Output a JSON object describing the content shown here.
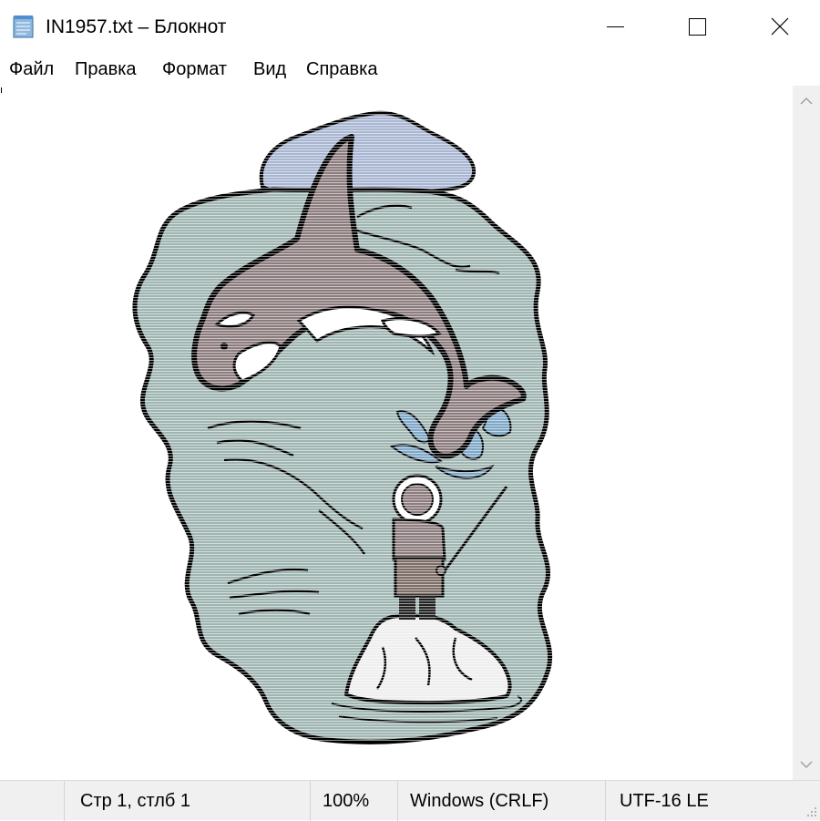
{
  "window": {
    "title": "IN1957.txt – Блокнот"
  },
  "menu": {
    "items": [
      "Файл",
      "Правка",
      "Формат",
      "Вид",
      "Справка"
    ]
  },
  "status": {
    "position": "Стр 1, стлб 1",
    "zoom": "100%",
    "line_ending": "Windows (CRLF)",
    "encoding": "UTF-16 LE"
  },
  "icons": {
    "app": "notepad-icon",
    "minimize": "minimize-icon",
    "maximize": "maximize-icon",
    "close": "close-icon"
  },
  "colors": {
    "water": "#9fb5b2",
    "sky": "#a9b6d2",
    "whale": "#8c7c7e",
    "ice": "#eeeeee",
    "outline": "#000000"
  }
}
